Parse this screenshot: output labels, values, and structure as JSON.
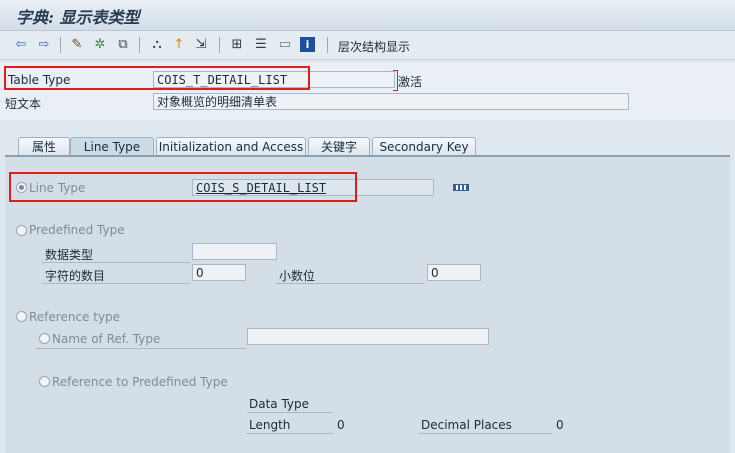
{
  "window": {
    "title": "字典: 显示表类型"
  },
  "toolbar": {
    "icons": [
      "back-arrow-icon",
      "forward-arrow-icon",
      "other-object-icon",
      "display-change-icon",
      "activate-icon",
      "where-used-icon",
      "object-list-icon",
      "navigate-icon",
      "hierarchy-icon",
      "print-icon",
      "layout-icon",
      "info-icon"
    ],
    "hierarchy_label": "层次结构显示"
  },
  "header": {
    "table_type_label": "Table Type",
    "table_type_value": "COIS_T_DETAIL_LIST",
    "status": "激活",
    "short_text_label": "短文本",
    "short_text_value": "对象概览的明细清单表"
  },
  "tabs": [
    "属性",
    "Line Type",
    "Initialization and Access",
    "关键字",
    "Secondary Key"
  ],
  "active_tab": "Line Type",
  "line_type": {
    "label": "Line Type",
    "value": "COIS_S_DETAIL_LIST"
  },
  "predefined": {
    "label": "Predefined Type",
    "data_type_label": "数据类型",
    "data_type_value": "",
    "num_chars_label": "字符的数目",
    "num_chars_value": "0",
    "decimals_label": "小数位",
    "decimals_value": "0"
  },
  "reference": {
    "label": "Reference type",
    "name_of_ref_label": "Name of Ref. Type",
    "name_of_ref_value": "",
    "ref_predef_label": "Reference to Predefined Type",
    "data_type_label": "Data Type",
    "length_label": "Length",
    "length_value": "0",
    "decimal_places_label": "Decimal Places",
    "decimal_places_value": "0"
  },
  "colors": {
    "highlight": "#e41b1b",
    "panel": "#d4dee6"
  }
}
